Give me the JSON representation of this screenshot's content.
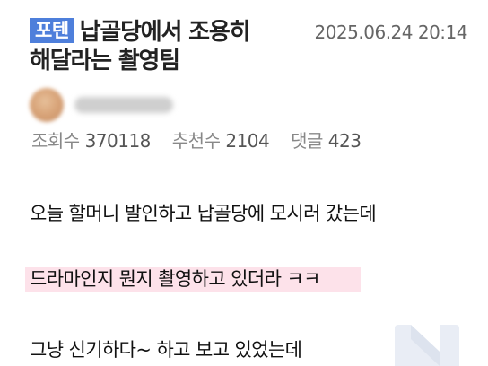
{
  "post": {
    "badge": "포텐",
    "title_line1": "납골당에서 조용히",
    "title_line2": "해달라는 촬영팀",
    "date": "2025.06.24 20:14"
  },
  "stats": {
    "views_label": "조회수",
    "views_value": "370118",
    "likes_label": "추천수",
    "likes_value": "2104",
    "comments_label": "댓글",
    "comments_value": "423"
  },
  "body": {
    "lines": [
      "오늘 할머니 발인하고 납골당에 모시러 갔는데",
      "드라마인지 뭔지 촬영하고 있더라 ㅋㅋ",
      "그냥 신기하다~ 하고 보고 있었는데"
    ]
  },
  "colors": {
    "badge": "#4e7fdb",
    "highlight": "#fde2ea"
  }
}
